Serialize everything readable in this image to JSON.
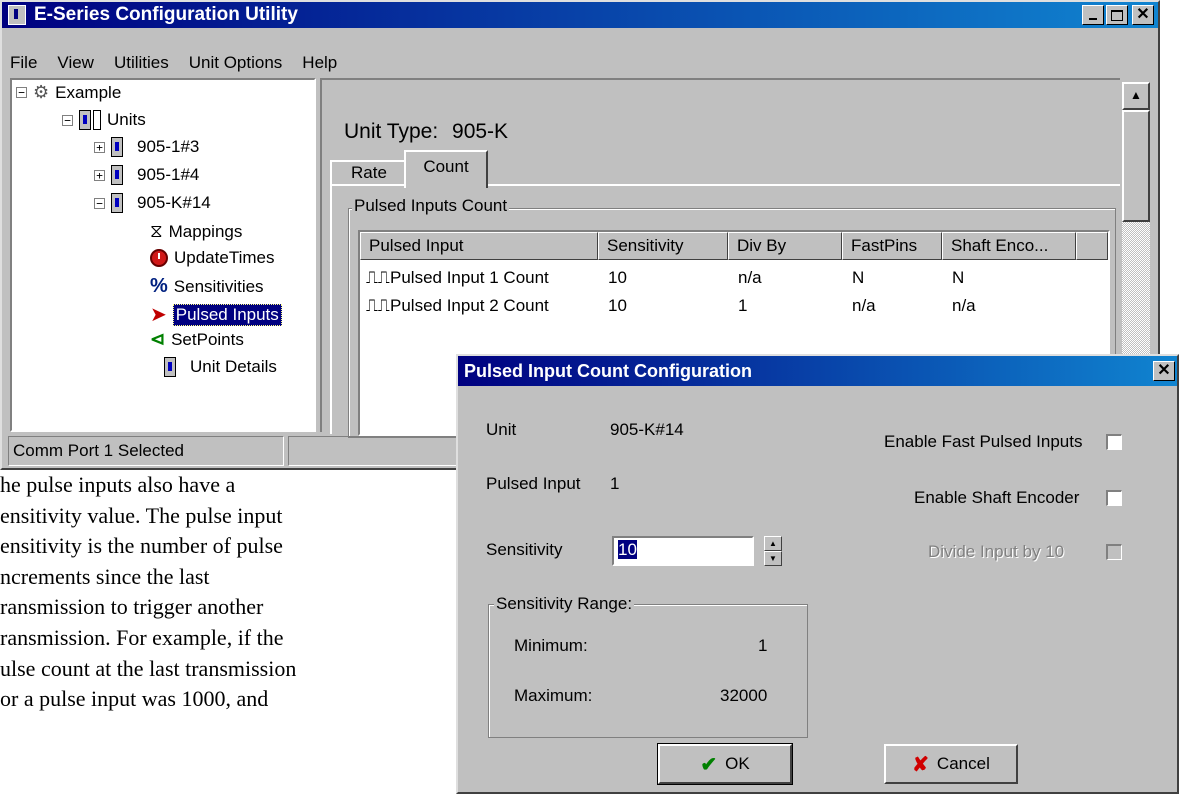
{
  "app": {
    "title": "E-Series Configuration Utility"
  },
  "menu": [
    "File",
    "View",
    "Utilities",
    "Unit Options",
    "Help"
  ],
  "tree": {
    "root": "Example",
    "units_label": "Units",
    "units": [
      "905-1#3",
      "905-1#4",
      "905-K#14"
    ],
    "children": [
      "Mappings",
      "UpdateTimes",
      "Sensitivities",
      "Pulsed Inputs",
      "SetPoints",
      "Unit Details"
    ],
    "selected": "Pulsed Inputs"
  },
  "status": {
    "text": "Comm Port 1 Selected"
  },
  "panel": {
    "unit_type_label": "Unit Type:",
    "unit_type_value": "905-K",
    "tabs": [
      "Rate",
      "Count"
    ],
    "active_tab": "Count",
    "group_label": "Pulsed Inputs Count",
    "columns": [
      "Pulsed Input",
      "Sensitivity",
      "Div By",
      "FastPins",
      "Shaft Enco..."
    ],
    "rows": [
      [
        "Pulsed Input 1 Count",
        "10",
        "n/a",
        "N",
        "N"
      ],
      [
        "Pulsed Input 2 Count",
        "10",
        "1",
        "n/a",
        "n/a"
      ]
    ]
  },
  "dialog": {
    "title": "Pulsed Input Count Configuration",
    "unit_label": "Unit",
    "unit_value": "905-K#14",
    "pulsed_input_label": "Pulsed Input",
    "pulsed_input_value": "1",
    "sensitivity_label": "Sensitivity",
    "sensitivity_value": "10",
    "range_label": "Sensitivity Range:",
    "minimum_label": "Minimum:",
    "minimum_value": "1",
    "maximum_label": "Maximum:",
    "maximum_value": "32000",
    "enable_fast_label": "Enable Fast Pulsed Inputs",
    "enable_fast_checked": false,
    "enable_shaft_label": "Enable Shaft Encoder",
    "enable_shaft_checked": false,
    "divide_label": "Divide Input by 10",
    "divide_checked": false,
    "ok_label": "OK",
    "cancel_label": "Cancel"
  },
  "document": {
    "lines": [
      "he pulse inputs also have a",
      "ensitivity value.  The pulse input",
      "ensitivity is the number of pulse",
      "ncrements since the last",
      "ransmission to trigger another",
      "ransmission.  For example,  if the",
      "ulse count at the last transmission",
      "or a pulse input was 1000,  and"
    ]
  },
  "colors": {
    "titlebar": "#000080",
    "face": "#c0c0c0",
    "selection": "#000080"
  }
}
